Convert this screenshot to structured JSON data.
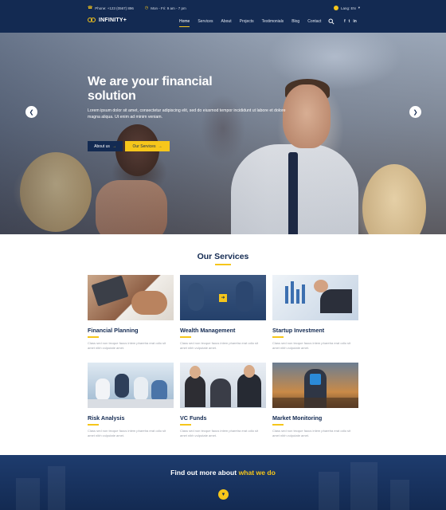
{
  "topbar": {
    "phone": "Phone: +123 (0567) 896",
    "hours": "Mon - Fri: 9 am - 7 pm",
    "lang": "Lang: EN"
  },
  "logo": {
    "text": "INFINITY+"
  },
  "nav": {
    "items": [
      "Home",
      "Services",
      "About",
      "Projects",
      "Testimonials",
      "Blog",
      "Contact"
    ],
    "active": "Home",
    "social": [
      "f",
      "t",
      "in"
    ]
  },
  "hero": {
    "title": "We are your financial solution",
    "text": "Lorem ipsum dolor sit amet, consectetur adipiscing elit, sed do eiusmod tempor incididunt ut labore et dolore magna aliqua. Ut enim ad minim veniam.",
    "btn_about": "About us",
    "btn_services": "Our Services"
  },
  "services": {
    "title": "Our Services",
    "cards": [
      {
        "title": "Financial Planning",
        "text": "Class sed non tecque faous intem pharetra erat odio sit amet nibh vulputate amet."
      },
      {
        "title": "Wealth Management",
        "text": "Class sed non tecque faous intem pharetra erat odio sit amet nibh vulputate amet."
      },
      {
        "title": "Startup Investment",
        "text": "Class sed non tecque faous intem pharetra erat odio sit amet nibh vulputate amet."
      },
      {
        "title": "Risk Analysis",
        "text": "Class sed non tecque faous intem pharetra erat odio sit amet nibh vulputate amet."
      },
      {
        "title": "VC Funds",
        "text": "Class sed non tecque faous intem pharetra erat odio sit amet nibh vulputate amet."
      },
      {
        "title": "Market Monitoring",
        "text": "Class sed non tecque faous intem pharetra erat odio sit amet nibh vulputate amet."
      }
    ]
  },
  "cta": {
    "text": "Find out more about",
    "highlight": "what we do"
  },
  "colors": {
    "navy": "#132a52",
    "accent": "#f6c61b"
  }
}
